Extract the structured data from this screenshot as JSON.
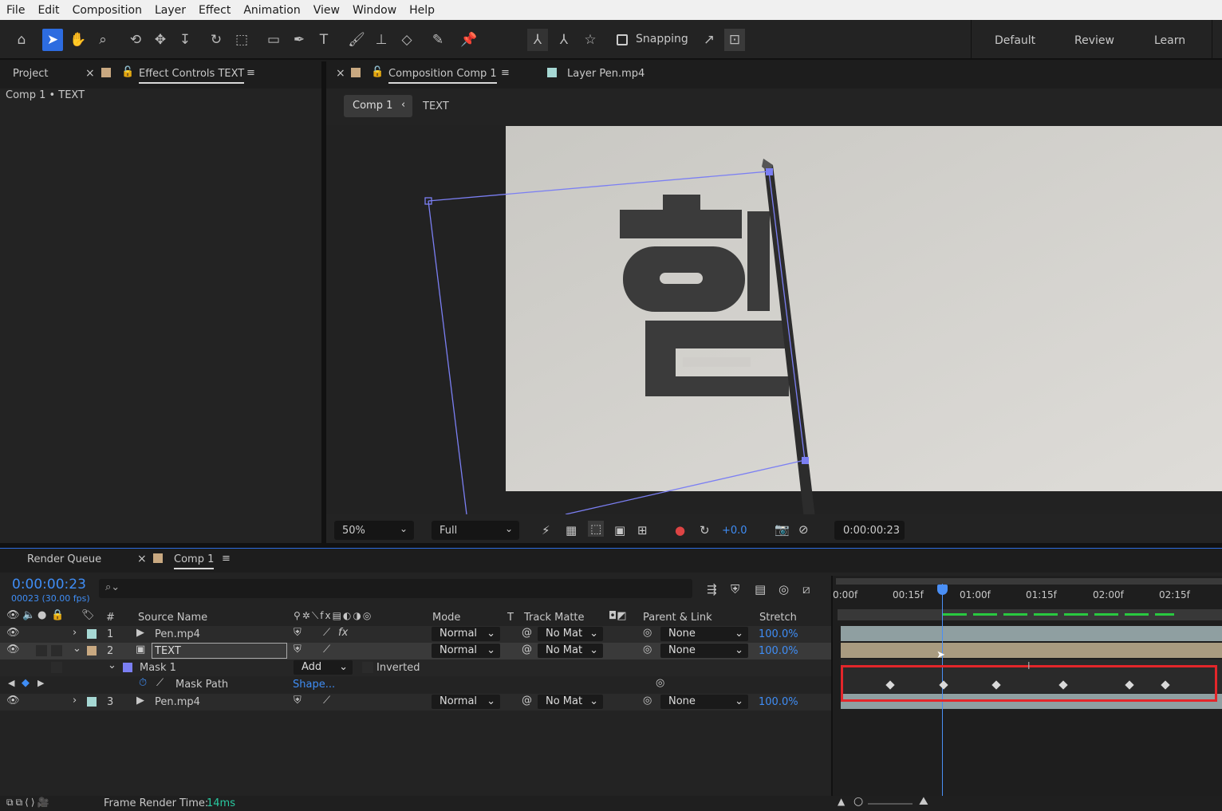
{
  "menu": [
    "File",
    "Edit",
    "Composition",
    "Layer",
    "Effect",
    "Animation",
    "View",
    "Window",
    "Help"
  ],
  "toolbar": {
    "snapping_label": "Snapping",
    "workspaces": [
      "Default",
      "Review",
      "Learn"
    ]
  },
  "left_panel": {
    "tab_project": "Project",
    "tab_effect_controls": "Effect Controls TEXT",
    "breadcrumb": "Comp 1 • TEXT"
  },
  "viewer": {
    "tab_composition": "Composition Comp 1",
    "tab_layer": "Layer Pen.mp4",
    "nav_comp": "Comp 1",
    "nav_layer": "TEXT",
    "zoom": "50%",
    "resolution": "Full",
    "exposure": "+0.0",
    "timecode": "0:00:00:23"
  },
  "timeline": {
    "tab_render_queue": "Render Queue",
    "tab_comp": "Comp 1",
    "current_time": "0:00:00:23",
    "frame_info": "00023 (30.00 fps)",
    "search_placeholder": "",
    "headers": {
      "num": "#",
      "source_name": "Source Name",
      "mode": "Mode",
      "t": "T",
      "track_matte": "Track Matte",
      "parent": "Parent & Link",
      "stretch": "Stretch"
    },
    "ruler": [
      "0:00f",
      "00:15f",
      "01:00f",
      "01:15f",
      "02:00f",
      "02:15f"
    ],
    "layers": [
      {
        "num": "1",
        "name": "Pen.mp4",
        "mode": "Normal",
        "matte": "No Mat",
        "parent": "None",
        "stretch": "100.0%"
      },
      {
        "num": "2",
        "name": "TEXT",
        "mode": "Normal",
        "matte": "No Mat",
        "parent": "None",
        "stretch": "100.0%"
      },
      {
        "num": "3",
        "name": "Pen.mp4",
        "mode": "Normal",
        "matte": "No Mat",
        "parent": "None",
        "stretch": "100.0%"
      }
    ],
    "mask": {
      "name": "Mask 1",
      "mode": "Add",
      "inverted_label": "Inverted",
      "property": "Mask Path",
      "value": "Shape..."
    },
    "footer_label": "Frame Render Time:",
    "footer_value": "14ms"
  }
}
